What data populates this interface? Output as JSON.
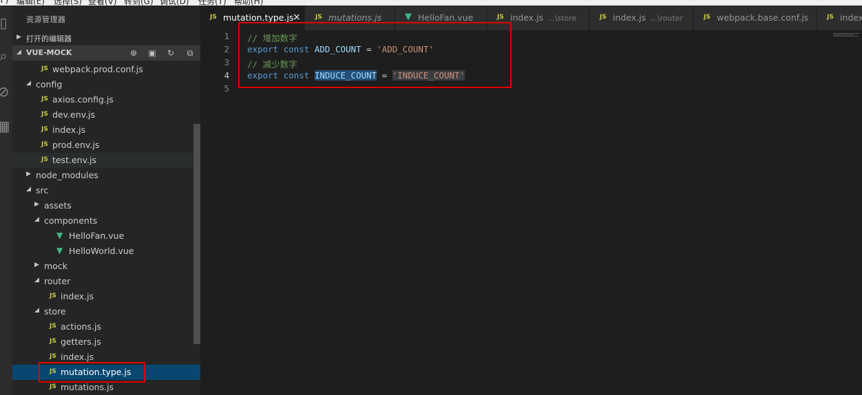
{
  "menubar": {
    "items": [
      "(F)",
      "编辑(E)",
      "选择(S)",
      "查看(V)",
      "转到(G)",
      "调试(D)",
      "任务(T)",
      "帮助(H)"
    ]
  },
  "sidebar": {
    "title": "资源管理器",
    "open_editors_label": "打开的编辑器",
    "project_label": "VUE-MOCK",
    "tree": [
      {
        "label": "webpack.prod.conf.js",
        "kind": "js",
        "depth": 2
      },
      {
        "label": "config",
        "kind": "folder-open",
        "depth": 1
      },
      {
        "label": "axios.config.js",
        "kind": "js",
        "depth": 2
      },
      {
        "label": "dev.env.js",
        "kind": "js",
        "depth": 2
      },
      {
        "label": "index.js",
        "kind": "js",
        "depth": 2
      },
      {
        "label": "prod.env.js",
        "kind": "js",
        "depth": 2
      },
      {
        "label": "test.env.js",
        "kind": "js",
        "depth": 2
      },
      {
        "label": "node_modules",
        "kind": "folder-closed",
        "depth": 1
      },
      {
        "label": "src",
        "kind": "folder-open",
        "depth": 1
      },
      {
        "label": "assets",
        "kind": "folder-closed",
        "depth": 2
      },
      {
        "label": "components",
        "kind": "folder-open",
        "depth": 2
      },
      {
        "label": "HelloFan.vue",
        "kind": "vue",
        "depth": 3
      },
      {
        "label": "HelloWorld.vue",
        "kind": "vue",
        "depth": 3
      },
      {
        "label": "mock",
        "kind": "folder-closed",
        "depth": 2
      },
      {
        "label": "router",
        "kind": "folder-open",
        "depth": 2
      },
      {
        "label": "index.js",
        "kind": "js",
        "depth": 3
      },
      {
        "label": "store",
        "kind": "folder-open",
        "depth": 2
      },
      {
        "label": "actions.js",
        "kind": "js",
        "depth": 3
      },
      {
        "label": "getters.js",
        "kind": "js",
        "depth": 3
      },
      {
        "label": "index.js",
        "kind": "js",
        "depth": 3
      },
      {
        "label": "mutation.type.js",
        "kind": "js",
        "depth": 3,
        "selected": true
      },
      {
        "label": "mutations.js",
        "kind": "js",
        "depth": 3
      }
    ]
  },
  "tabs": [
    {
      "label": "mutation.type.js",
      "kind": "js",
      "active": true,
      "italic": false,
      "desc": "",
      "close": "×"
    },
    {
      "label": "mutations.js",
      "kind": "js",
      "active": false,
      "italic": true,
      "desc": ""
    },
    {
      "label": "HelloFan.vue",
      "kind": "vue",
      "active": false,
      "italic": false,
      "desc": ""
    },
    {
      "label": "index.js",
      "kind": "js",
      "active": false,
      "italic": false,
      "desc": "...\\store"
    },
    {
      "label": "index.js",
      "kind": "js",
      "active": false,
      "italic": false,
      "desc": "...\\router"
    },
    {
      "label": "webpack.base.conf.js",
      "kind": "js",
      "active": false,
      "italic": false,
      "desc": ""
    },
    {
      "label": "index",
      "kind": "js",
      "active": false,
      "italic": false,
      "desc": ""
    }
  ],
  "editor": {
    "line_numbers": [
      "1",
      "2",
      "3",
      "4",
      "5"
    ],
    "current_line": "4",
    "lines": [
      [
        {
          "t": "// 增加数字",
          "c": "comment"
        }
      ],
      [
        {
          "t": "export",
          "c": "keyword"
        },
        {
          "t": " ",
          "c": "plain"
        },
        {
          "t": "const",
          "c": "keyword"
        },
        {
          "t": " ",
          "c": "plain"
        },
        {
          "t": "ADD_COUNT",
          "c": "ident"
        },
        {
          "t": " = ",
          "c": "plain"
        },
        {
          "t": "'ADD_COUNT'",
          "c": "string"
        }
      ],
      [
        {
          "t": "// 减少数字",
          "c": "comment"
        }
      ],
      [
        {
          "t": "export",
          "c": "keyword"
        },
        {
          "t": " ",
          "c": "plain"
        },
        {
          "t": "const",
          "c": "keyword"
        },
        {
          "t": " ",
          "c": "plain"
        },
        {
          "t": "INDUCE_COUNT",
          "c": "ident",
          "hl": "selection"
        },
        {
          "t": " = ",
          "c": "plain"
        },
        {
          "t": "'INDUCE_COUNT'",
          "c": "string",
          "hl": "word"
        }
      ],
      []
    ]
  },
  "icons": {
    "js_badge": "JS",
    "vue_badge": "V",
    "new_file": "new-file-icon",
    "new_folder": "new-folder-icon",
    "refresh": "refresh-icon",
    "collapse": "collapse-all-icon"
  },
  "colors": {
    "annotation": "#e00000",
    "selection": "#094771"
  }
}
